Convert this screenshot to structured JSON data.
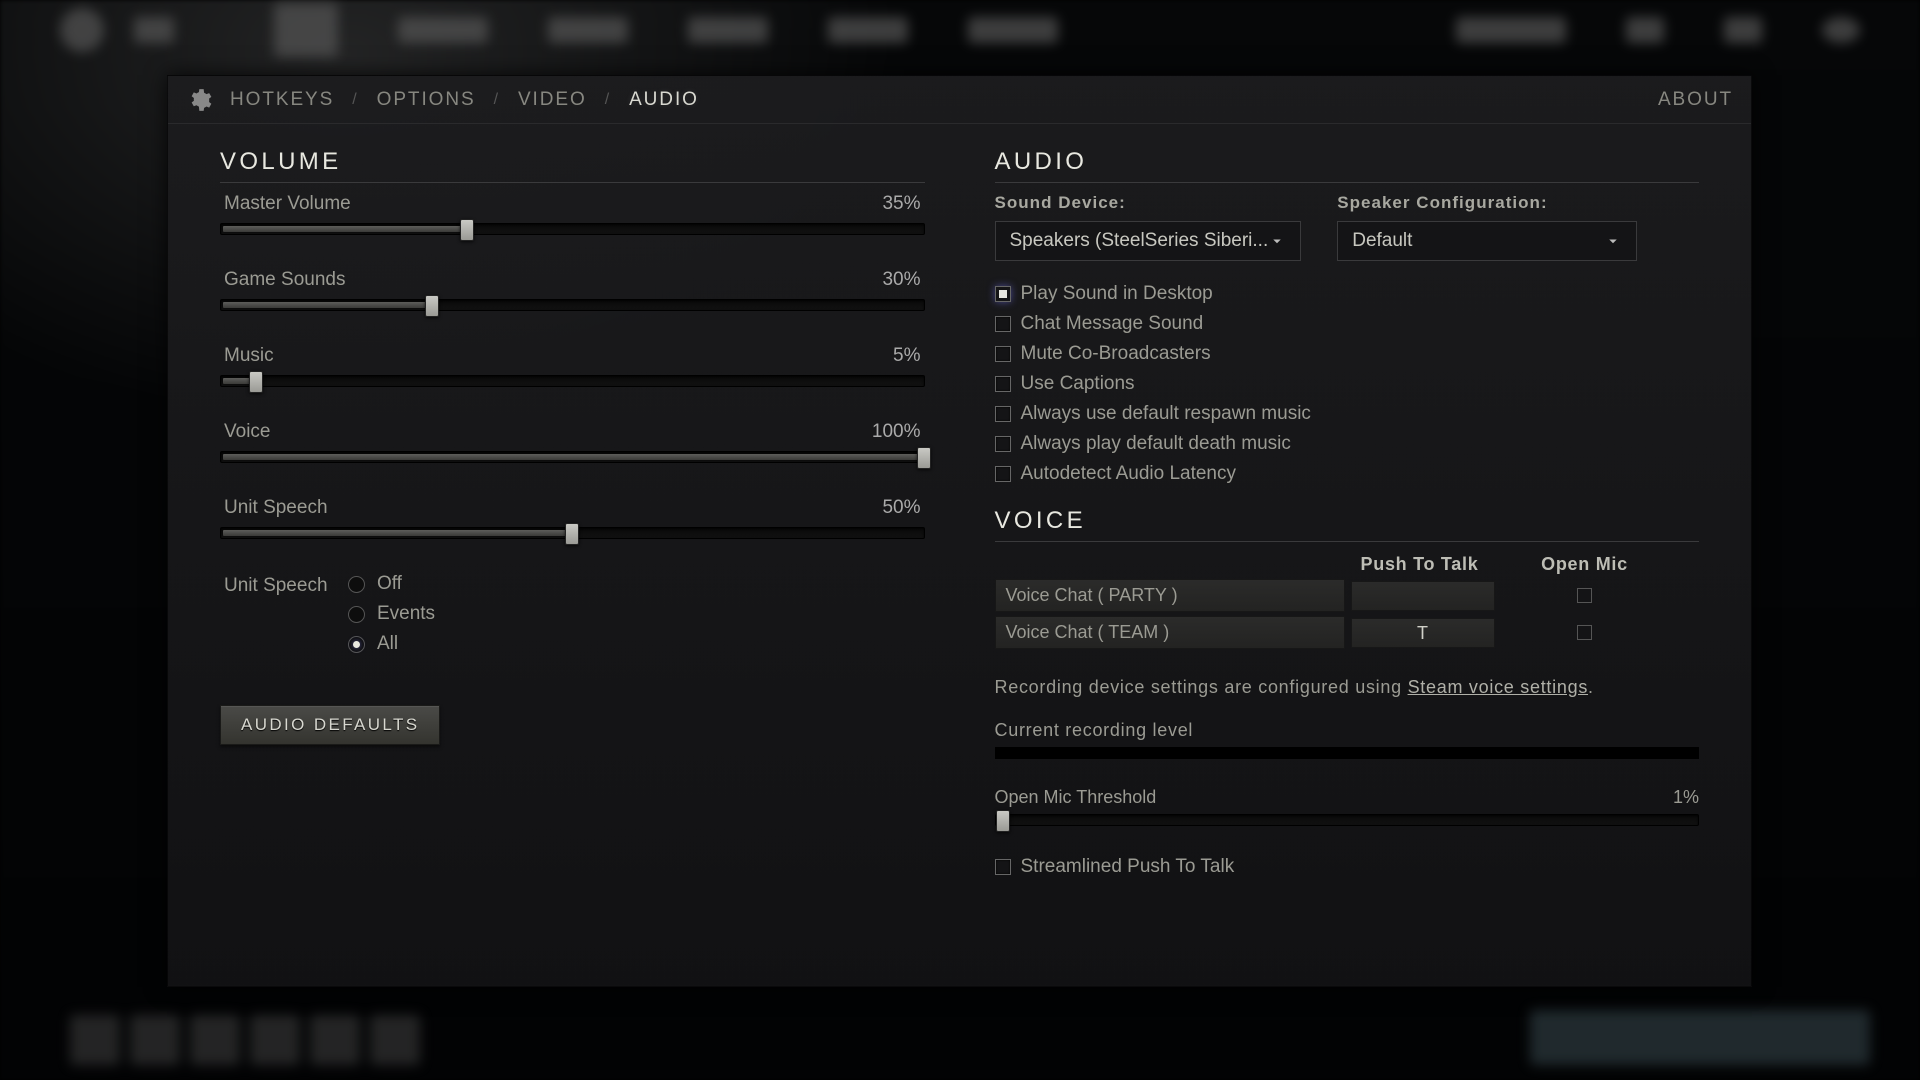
{
  "tabs": {
    "hotkeys": "HOTKEYS",
    "options": "OPTIONS",
    "video": "VIDEO",
    "audio": "AUDIO",
    "about": "ABOUT",
    "sep": "/"
  },
  "volume": {
    "title": "VOLUME",
    "sliders": [
      {
        "label": "Master Volume",
        "value": 35,
        "display": "35%"
      },
      {
        "label": "Game Sounds",
        "value": 30,
        "display": "30%"
      },
      {
        "label": "Music",
        "value": 5,
        "display": "5%"
      },
      {
        "label": "Voice",
        "value": 100,
        "display": "100%"
      },
      {
        "label": "Unit Speech",
        "value": 50,
        "display": "50%"
      }
    ],
    "unit_speech_label": "Unit Speech",
    "unit_speech_options": {
      "off": {
        "label": "Off",
        "checked": false
      },
      "events": {
        "label": "Events",
        "checked": false
      },
      "all": {
        "label": "All",
        "checked": true
      }
    },
    "defaults_btn": "AUDIO DEFAULTS"
  },
  "audio": {
    "title": "AUDIO",
    "sound_device_label": "Sound Device:",
    "sound_device_value": "Speakers (SteelSeries Siberi...",
    "speaker_cfg_label": "Speaker Configuration:",
    "speaker_cfg_value": "Default",
    "checks": [
      {
        "label": "Play Sound in Desktop",
        "checked": true
      },
      {
        "label": "Chat Message Sound",
        "checked": false
      },
      {
        "label": "Mute Co-Broadcasters",
        "checked": false
      },
      {
        "label": "Use Captions",
        "checked": false
      },
      {
        "label": "Always use default respawn music",
        "checked": false
      },
      {
        "label": "Always play default death music",
        "checked": false
      },
      {
        "label": "Autodetect Audio Latency",
        "checked": false
      }
    ]
  },
  "voice": {
    "title": "VOICE",
    "col_ptt": "Push To Talk",
    "col_open": "Open Mic",
    "rows": {
      "party": {
        "label": "Voice Chat ( PARTY )",
        "key": ""
      },
      "team": {
        "label": "Voice Chat ( TEAM )",
        "key": "T"
      }
    },
    "rec_text_a": "Recording device settings are configured using ",
    "rec_link": "Steam voice settings",
    "rec_text_b": ".",
    "level_label": "Current recording level",
    "threshold_label": "Open Mic Threshold",
    "threshold_value": 1,
    "threshold_display": "1%",
    "streamlined": {
      "label": "Streamlined Push To Talk",
      "checked": false
    }
  }
}
